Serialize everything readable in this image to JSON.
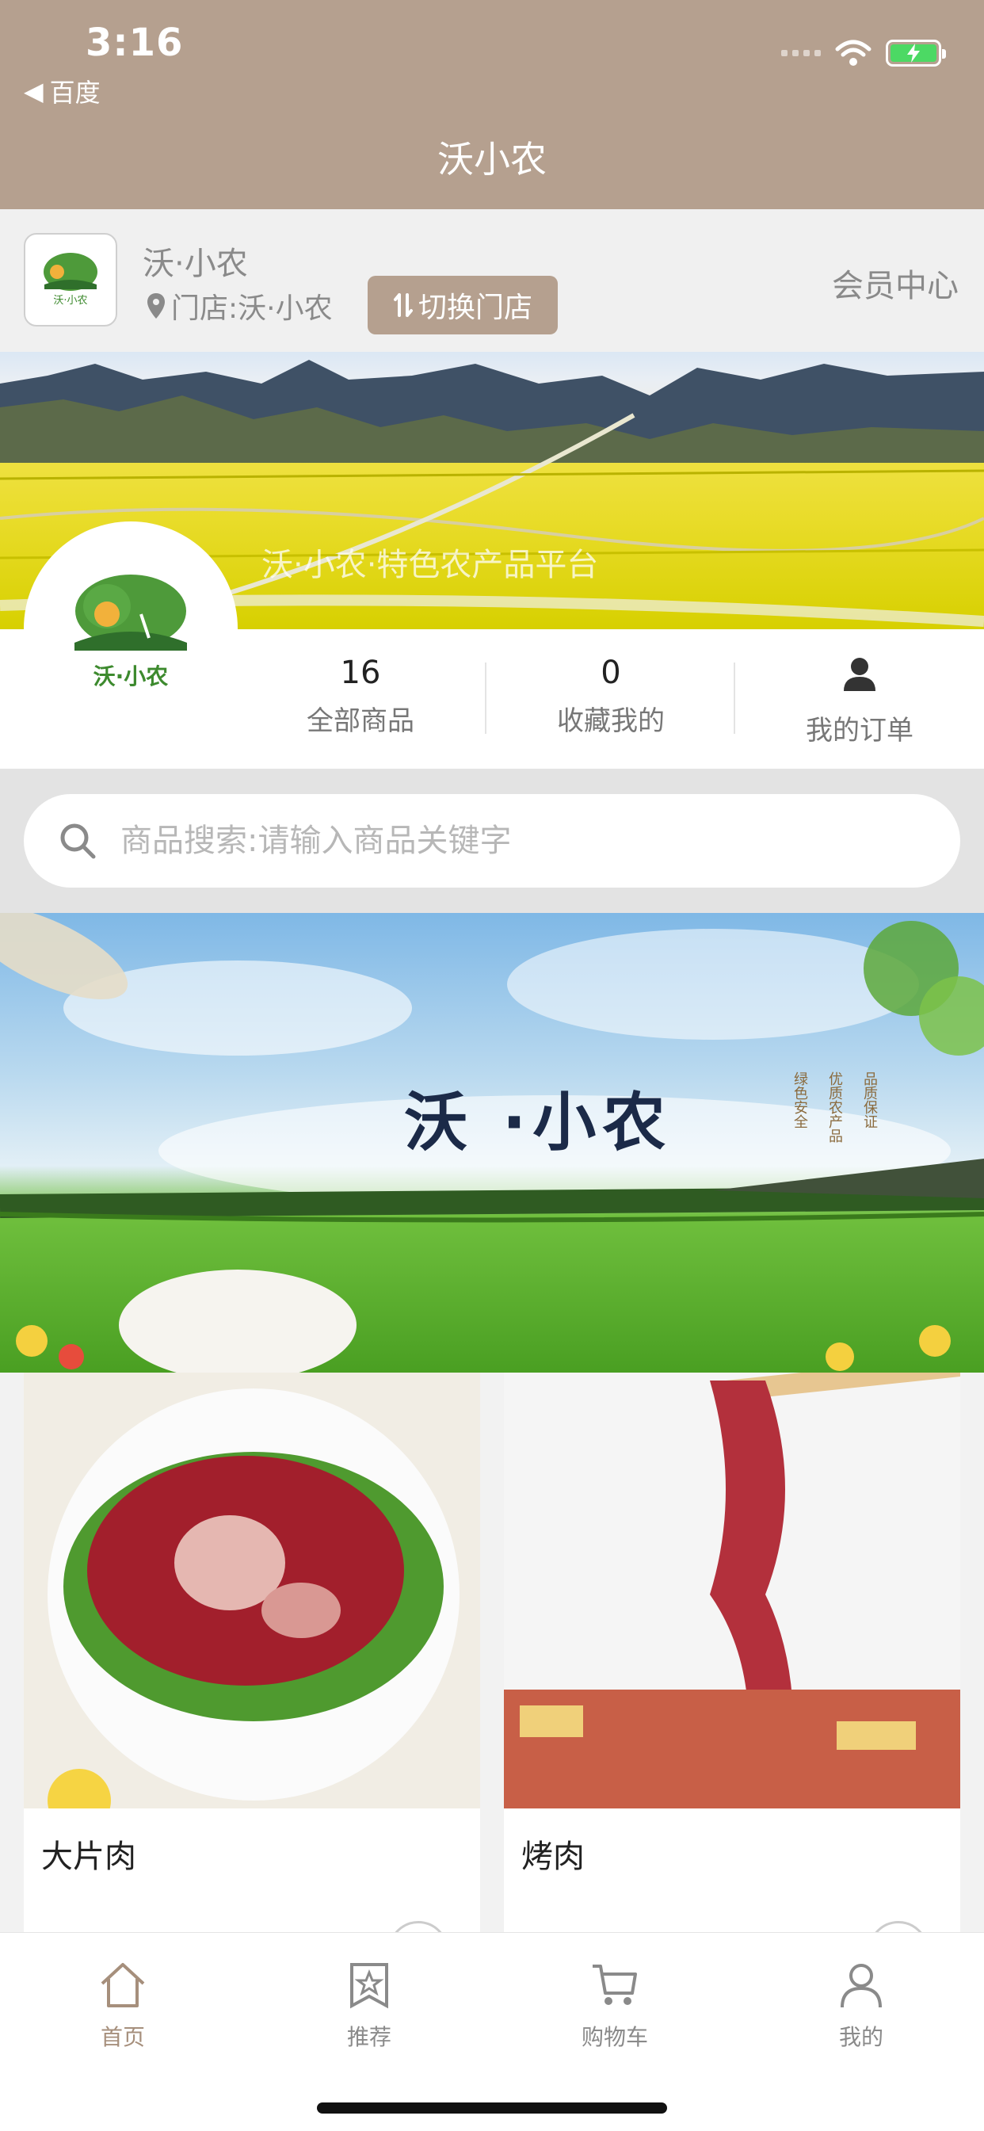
{
  "status_bar": {
    "time": "3:16",
    "back_app": "百度"
  },
  "nav": {
    "title": "沃小农"
  },
  "store": {
    "name": "沃·小农",
    "shop_label": "门店:沃·小农",
    "switch_label": "切换门店",
    "member_center": "会员中心"
  },
  "banner1": {
    "caption": "沃·小农·特色农产品平台"
  },
  "avatar": {
    "logo_text": "沃·小农"
  },
  "stats": {
    "all_products_count": "16",
    "all_products_label": "全部商品",
    "favorites_count": "0",
    "favorites_label": "收藏我的",
    "orders_label": "我的订单"
  },
  "search": {
    "placeholder": "商品搜索:请输入商品关键字"
  },
  "banner2": {
    "brand": "沃 ·小农",
    "slogans": [
      "绿色安全",
      "优质农产品",
      "品质保证"
    ]
  },
  "products": [
    {
      "name": "大片肉"
    },
    {
      "name": "烤肉"
    }
  ],
  "tabbar": {
    "items": [
      {
        "label": "首页",
        "icon": "home-icon"
      },
      {
        "label": "推荐",
        "icon": "star-badge-icon"
      },
      {
        "label": "购物车",
        "icon": "cart-icon"
      },
      {
        "label": "我的",
        "icon": "user-icon"
      }
    ]
  },
  "colors": {
    "accent": "#b5a08f",
    "active_tab": "#a68f7c",
    "battery": "#4cd964"
  }
}
